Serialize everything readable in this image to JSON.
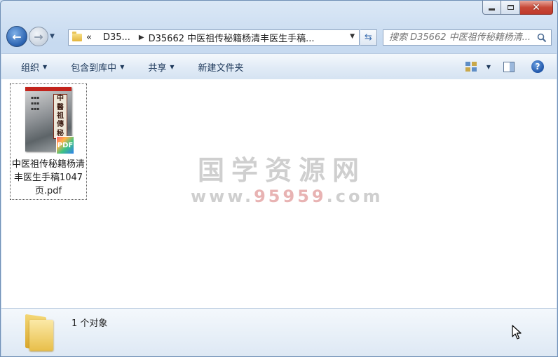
{
  "window": {
    "caption": {
      "minimize": "minimize",
      "maximize": "maximize",
      "close": "✕"
    }
  },
  "nav": {
    "back": "back",
    "forward": "forward"
  },
  "address": {
    "overflow": "«",
    "crumbs": [
      "D35...",
      "D35662 中医祖传秘籍杨清丰医生手稿..."
    ]
  },
  "search": {
    "placeholder": "搜索 D35662 中医祖传秘籍杨清..."
  },
  "toolbar": {
    "organize": "组织",
    "include_in_library": "包含到库中",
    "share": "共享",
    "new_folder": "新建文件夹"
  },
  "files": [
    {
      "name": "中医祖传秘籍杨清丰医生手稿1047页.pdf",
      "cover_chars": [
        "中",
        "醫",
        "祖",
        "傳",
        "秘"
      ],
      "badge": "PDF"
    }
  ],
  "watermark": {
    "title": "国学资源网",
    "url_pre": "www.",
    "url_hi": "95959",
    "url_post": ".com"
  },
  "details": {
    "count": "1 个对象"
  },
  "colors": {
    "accent": "#1e395b",
    "selection_border": "#555555"
  }
}
